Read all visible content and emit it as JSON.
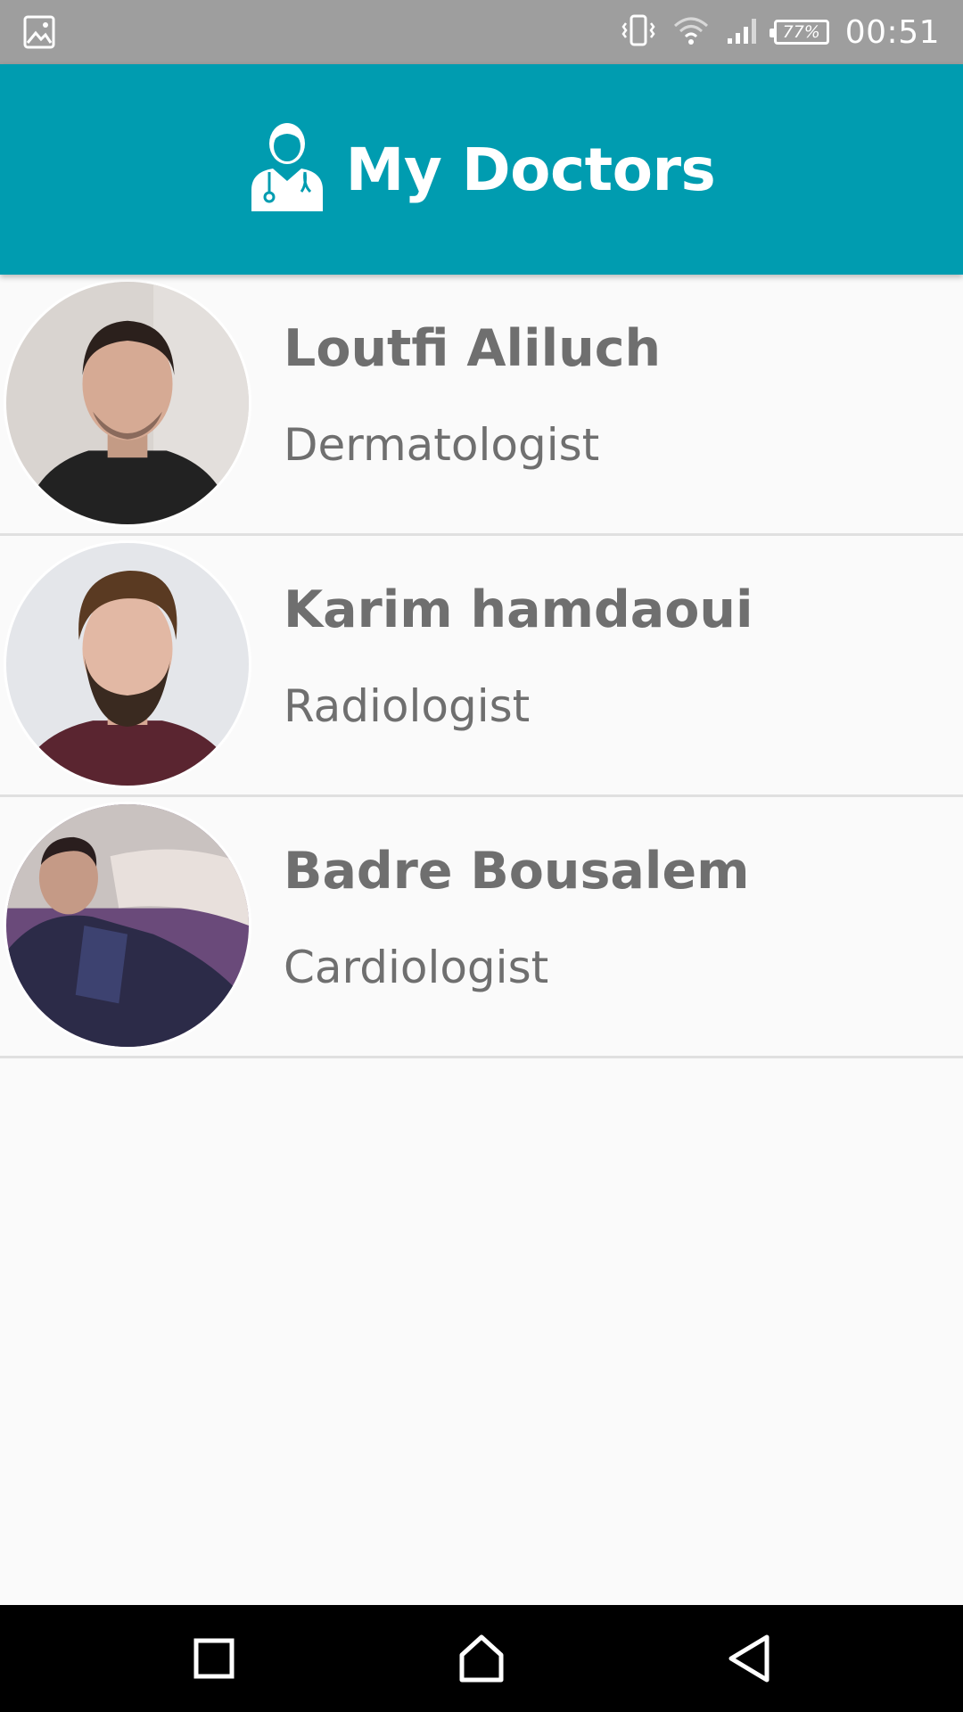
{
  "status_bar": {
    "time": "00:51",
    "battery": "77%",
    "icons": [
      "image-icon",
      "vibrate-icon",
      "wifi-icon",
      "signal-icon",
      "battery-icon"
    ]
  },
  "app_bar": {
    "title": "My Doctors",
    "icon": "doctor-icon",
    "color": "#009cb0"
  },
  "doctors": [
    {
      "name": "Loutfi Aliluch",
      "specialty": "Dermatologist"
    },
    {
      "name": "Karim hamdaoui",
      "specialty": "Radiologist"
    },
    {
      "name": "Badre Bousalem",
      "specialty": "Cardiologist"
    }
  ],
  "nav_bar": {
    "buttons": [
      "recents-icon",
      "home-icon",
      "back-icon"
    ]
  }
}
